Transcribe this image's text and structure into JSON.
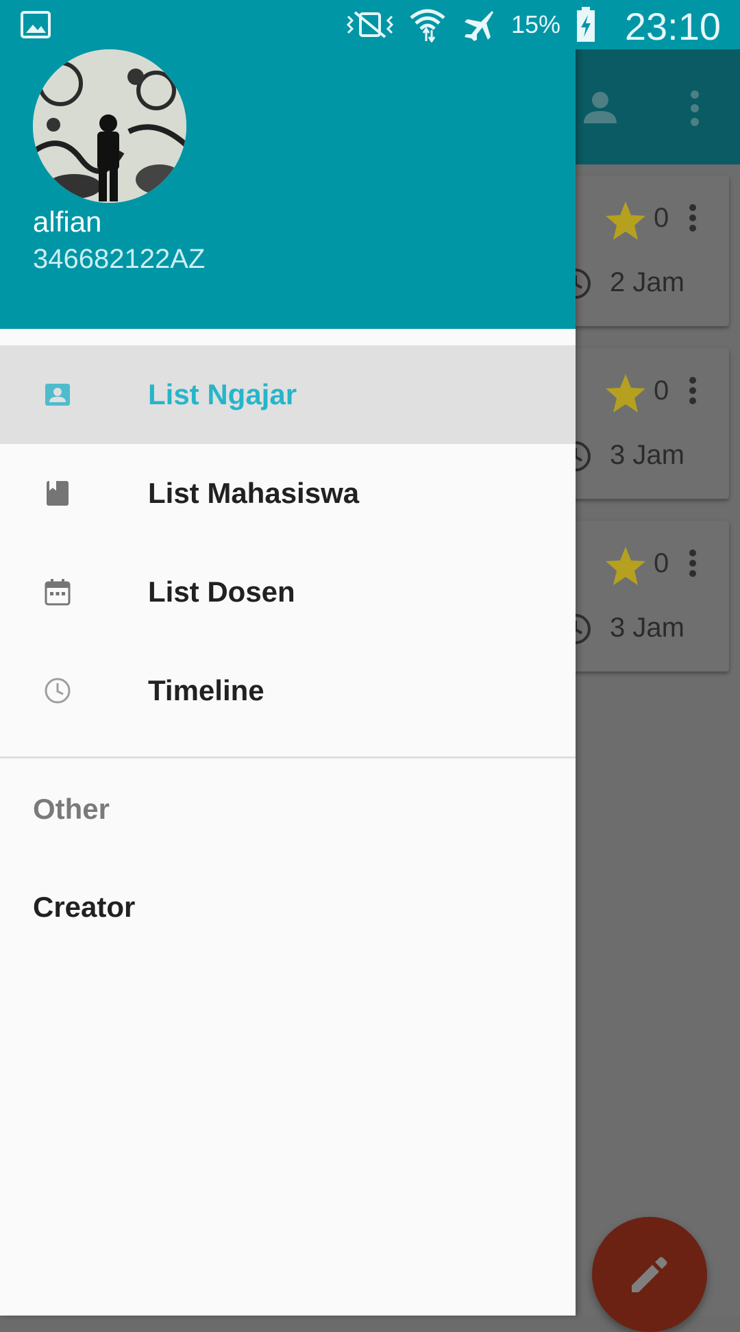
{
  "status_bar": {
    "battery_percent": "15%",
    "time": "23:10",
    "icons": [
      "gallery-icon",
      "vibrate-mute-icon",
      "wifi-icon",
      "airplane-icon",
      "battery-charging-icon"
    ]
  },
  "drawer": {
    "header": {
      "user_name": "alfian",
      "user_id": "346682122AZ"
    },
    "menu": [
      {
        "label": "List Ngajar",
        "icon": "contact-card-icon",
        "active": true
      },
      {
        "label": "List Mahasiswa",
        "icon": "book-icon",
        "active": false
      },
      {
        "label": "List Dosen",
        "icon": "calendar-icon",
        "active": false
      },
      {
        "label": "Timeline",
        "icon": "clock-icon",
        "active": false
      }
    ],
    "section_other": "Other",
    "creator_label": "Creator"
  },
  "background": {
    "cards": [
      {
        "likes": "0",
        "duration": "2 Jam"
      },
      {
        "likes": "0",
        "duration": "3 Jam"
      },
      {
        "likes": "0",
        "duration": "3 Jam"
      }
    ]
  },
  "colors": {
    "primary": "#0096a6",
    "accent_text": "#26b5c9",
    "star": "#b5a11f",
    "fab": "#6b2212"
  }
}
